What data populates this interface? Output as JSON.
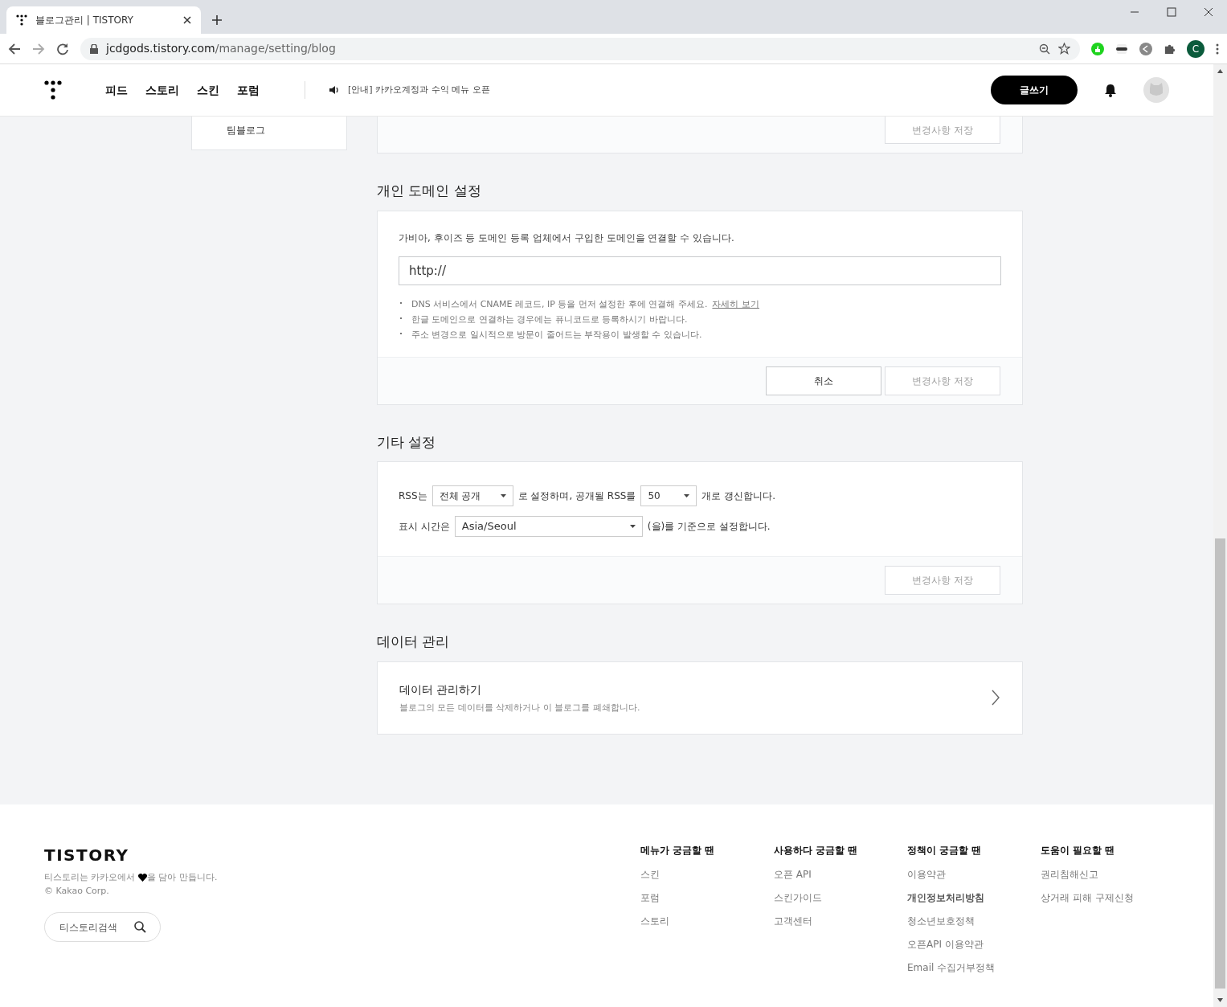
{
  "browser": {
    "tab_title": "블로그관리 | TISTORY",
    "url_host": "jcdgods.tistory.com",
    "url_path": "/manage/setting/blog",
    "profile_initial": "C"
  },
  "header": {
    "nav": [
      "피드",
      "스토리",
      "스킨",
      "포럼"
    ],
    "notice": "[안내] 카카오계정과 수익 메뉴 오픈",
    "write_button": "글쓰기"
  },
  "sidebar": {
    "items": [
      "팀블로그"
    ]
  },
  "top_card": {
    "save_button": {
      "label": "변경사항 저장",
      "disabled": true
    }
  },
  "domain_section": {
    "title": "개인 도메인 설정",
    "description": "가비아, 후이즈 등 도메인 등록 업체에서 구입한 도메인을 연결할 수 있습니다.",
    "input_value": "http://",
    "notes": [
      {
        "text": "DNS 서비스에서 CNAME 레코드, IP 등을 먼저 설정한 후에 연결해 주세요.",
        "link": "자세히 보기"
      },
      {
        "text": "한글 도메인으로 연결하는 경우에는 퓨니코드로 등록하시기 바랍니다."
      },
      {
        "text": "주소 변경으로 일시적으로 방문이 줄어드는 부작용이 발생할 수 있습니다."
      }
    ],
    "cancel_button": "취소",
    "save_button": {
      "label": "변경사항 저장",
      "disabled": true
    }
  },
  "other_section": {
    "title": "기타 설정",
    "rss_prefix": "RSS는",
    "rss_visibility": "전체 공개",
    "rss_middle": "로 설정하며, 공개될 RSS를",
    "rss_count": "50",
    "rss_suffix": "개로 갱신합니다.",
    "time_prefix": "표시 시간은",
    "timezone": "Asia/Seoul",
    "time_suffix": "(을)를 기준으로 설정합니다.",
    "save_button": {
      "label": "변경사항 저장",
      "disabled": true
    }
  },
  "data_section": {
    "title": "데이터 관리",
    "item_title": "데이터 관리하기",
    "item_description": "블로그의 모든 데이터를 삭제하거나 이 블로그를 폐쇄합니다."
  },
  "footer": {
    "logo": "TISTORY",
    "tagline_before": "티스토리는 카카오에서",
    "tagline_after": "을 담아 만듭니다.",
    "copyright": "© Kakao Corp.",
    "search_label": "티스토리검색",
    "columns": [
      {
        "heading": "메뉴가 궁금할 땐",
        "links": [
          {
            "label": "스킨",
            "emphasized": false
          },
          {
            "label": "포럼",
            "emphasized": false
          },
          {
            "label": "스토리",
            "emphasized": false
          }
        ]
      },
      {
        "heading": "사용하다 궁금할 땐",
        "links": [
          {
            "label": "오픈 API",
            "emphasized": false
          },
          {
            "label": "스킨가이드",
            "emphasized": false
          },
          {
            "label": "고객센터",
            "emphasized": false
          }
        ]
      },
      {
        "heading": "정책이 궁금할 땐",
        "links": [
          {
            "label": "이용약관",
            "emphasized": false
          },
          {
            "label": "개인정보처리방침",
            "emphasized": true
          },
          {
            "label": "청소년보호정책",
            "emphasized": false
          },
          {
            "label": "오픈API 이용약관",
            "emphasized": false
          },
          {
            "label": "Email 수집거부정책",
            "emphasized": false
          }
        ]
      },
      {
        "heading": "도움이 필요할 땐",
        "links": [
          {
            "label": "권리침해신고",
            "emphasized": false
          },
          {
            "label": "상거래 피해 구제신청",
            "emphasized": false
          }
        ]
      }
    ]
  }
}
